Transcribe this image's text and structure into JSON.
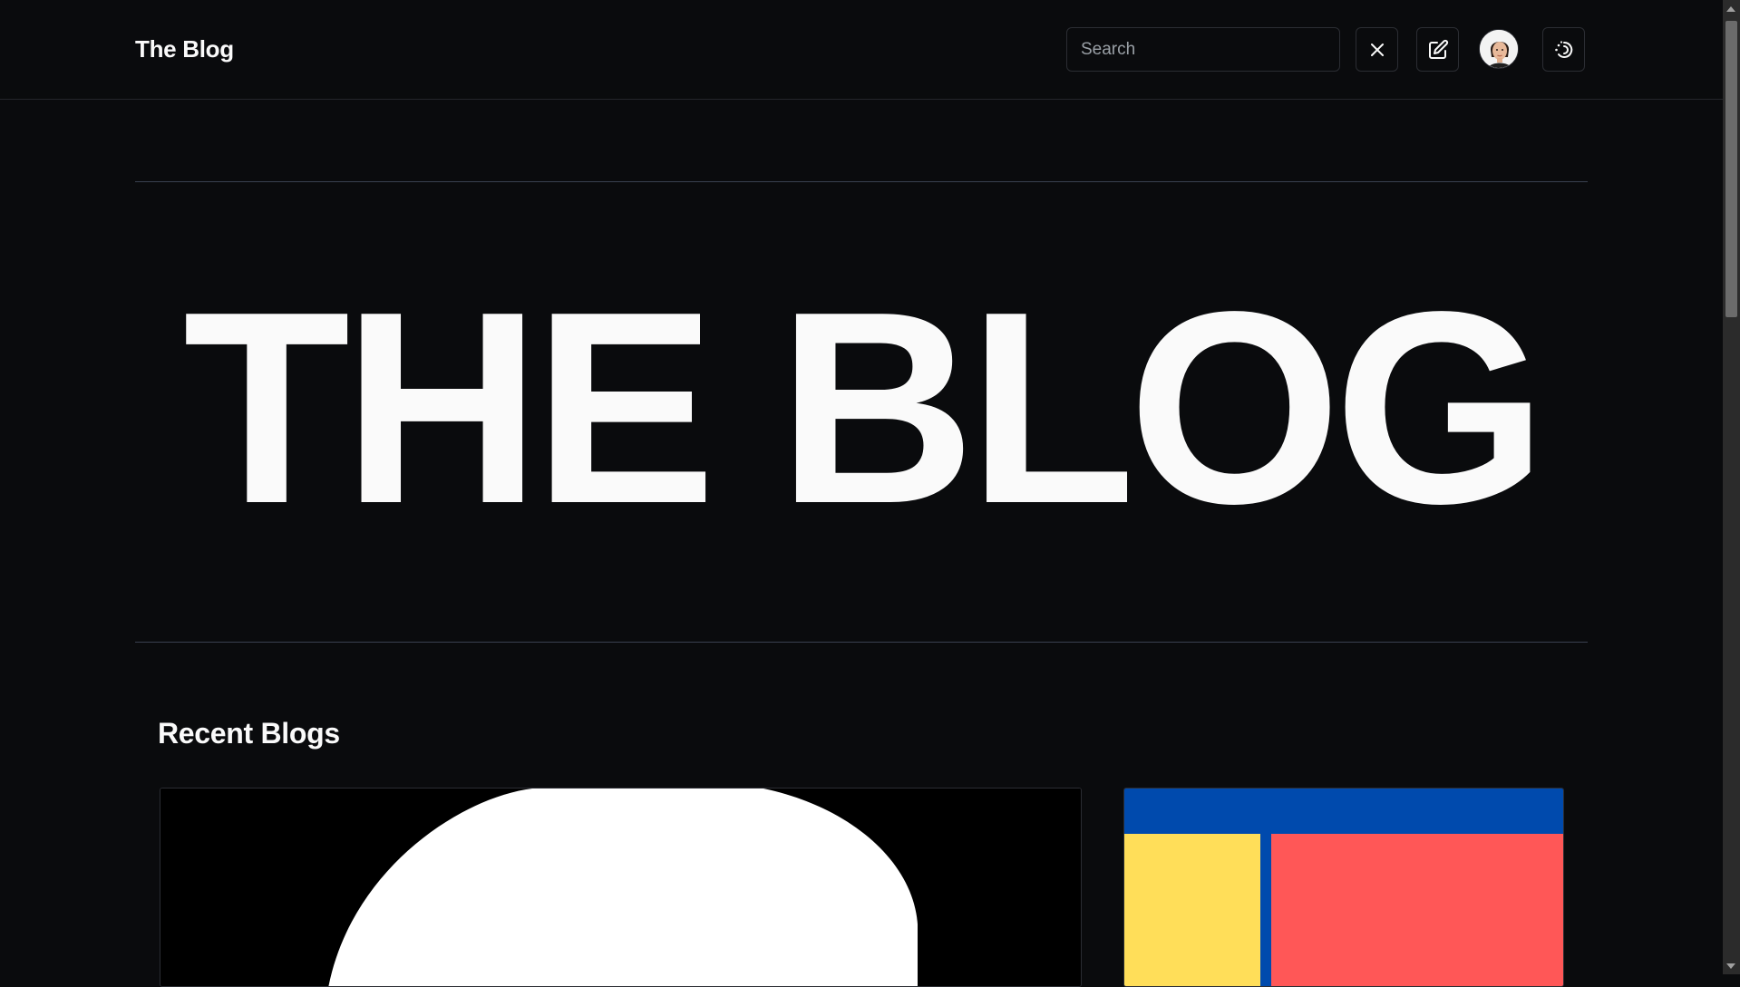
{
  "header": {
    "brand": "The Blog",
    "search_placeholder": "Search",
    "search_value": "",
    "icons": [
      "close-icon",
      "edit-icon",
      "avatar",
      "theme-toggle-icon"
    ]
  },
  "hero": {
    "title": "THE BLOG"
  },
  "recent": {
    "title": "Recent Blogs"
  },
  "colors": {
    "background": "#0a0b0d",
    "text": "#fafafa",
    "rule": "#3a4150",
    "card_blue": "#004aad",
    "card_yellow": "#ffde59",
    "card_red": "#ff5757"
  }
}
